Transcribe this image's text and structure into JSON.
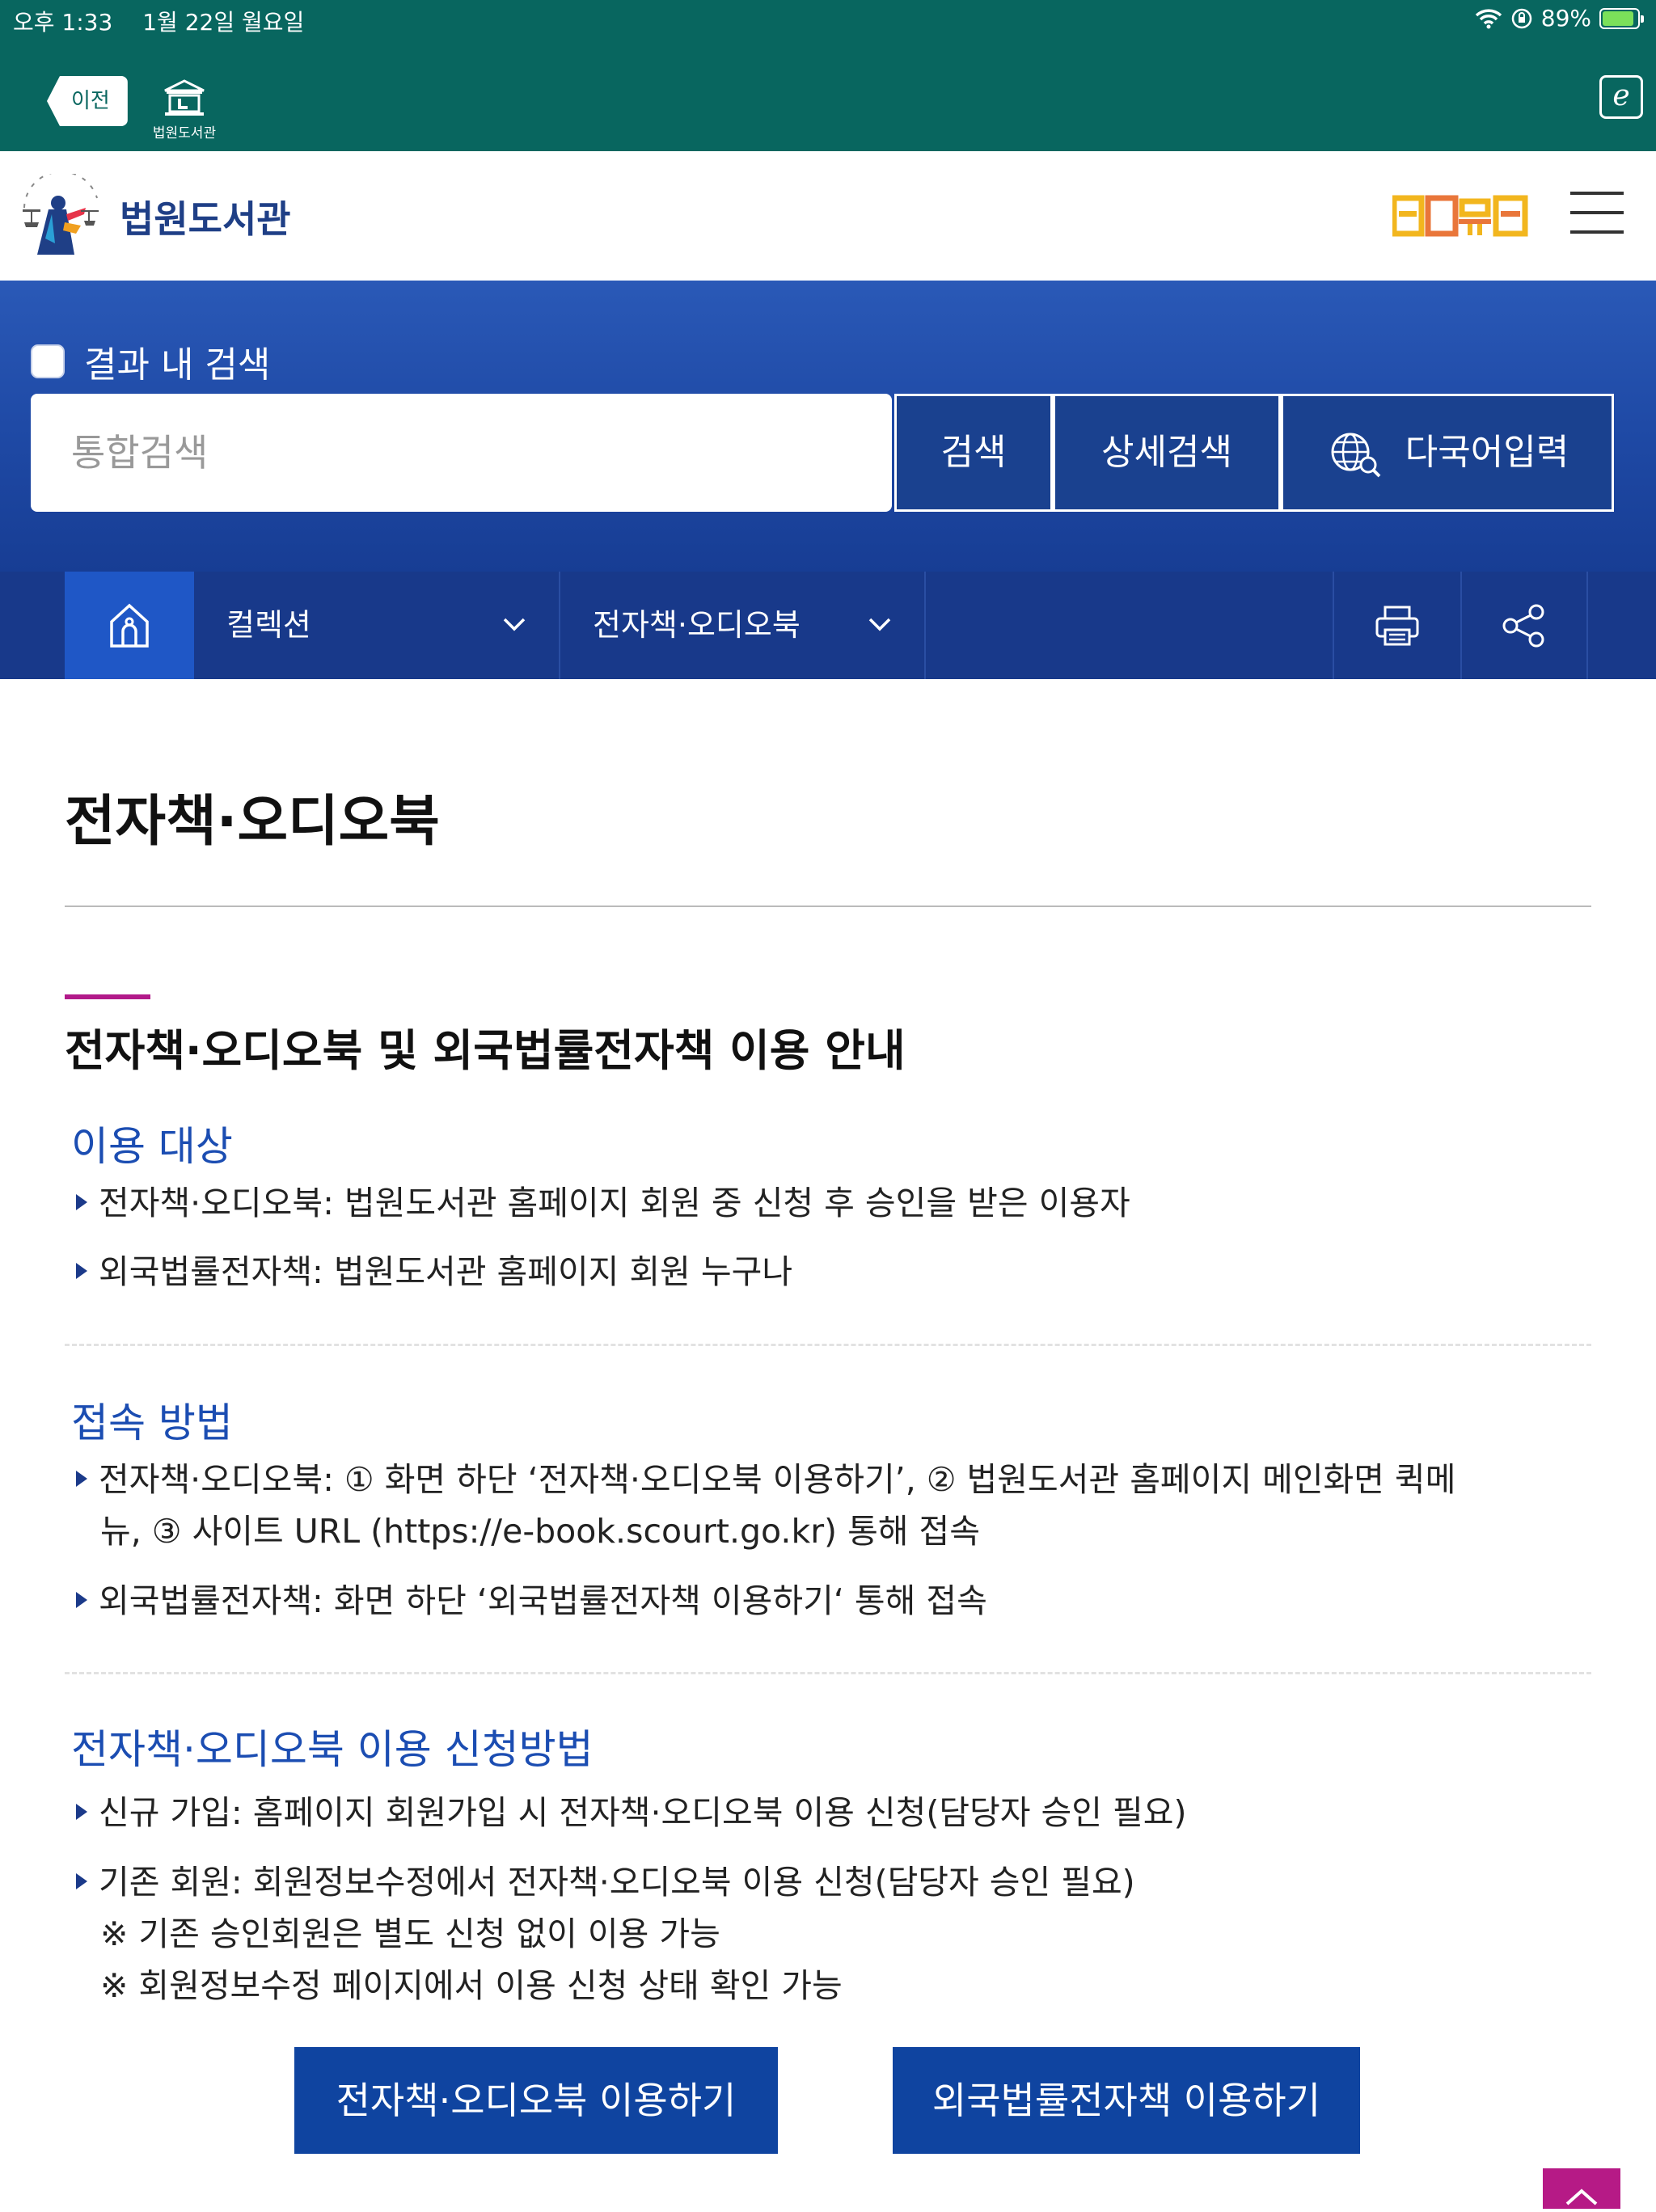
{
  "status_bar": {
    "time": "오후 1:33",
    "date": "1월 22일 월요일",
    "battery": "89%"
  },
  "toolbar": {
    "back_label": "이전",
    "library_label": "법원도서관"
  },
  "header": {
    "site_name": "법원도서관",
    "baro_logo": "바로마루"
  },
  "search": {
    "checkbox_label": "결과 내 검색",
    "placeholder": "통합검색",
    "search_button": "검색",
    "detail_button": "상세검색",
    "multilang_button": "다국어입력"
  },
  "nav": {
    "collection": "컬렉션",
    "ebook": "전자책·오디오북"
  },
  "content": {
    "page_title": "전자책·오디오북",
    "section_title": "전자책·오디오북 및 외국법률전자책 이용 안내",
    "usage_target": {
      "title": "이용 대상",
      "items": [
        "전자책·오디오북: 법원도서관 홈페이지 회원 중 신청 후 승인을 받은 이용자",
        "외국법률전자책: 법원도서관 홈페이지 회원 누구나"
      ]
    },
    "access_method": {
      "title": "접속 방법",
      "item1_line1": "전자책·오디오북: ① 화면 하단 ‘전자책·오디오북 이용하기’, ② 법원도서관 홈페이지 메인화면 퀵메",
      "item1_line2": "뉴, ③ 사이트 URL (https://e-book.scourt.go.kr) 통해 접속",
      "item2": "외국법률전자책: 화면 하단 ‘외국법률전자책 이용하기‘ 통해 접속"
    },
    "apply_method": {
      "title": "전자책·오디오북 이용 신청방법",
      "item1": "신규 가입: 홈페이지 회원가입 시 전자책·오디오북 이용 신청(담당자 승인 필요)",
      "item2": "기존 회원: 회원정보수정에서 전자책·오디오북 이용 신청(담당자 승인 필요)",
      "note1": "※ 기존 승인회원은 별도 신청 없이 이용 가능",
      "note2": "※ 회원정보수정 페이지에서 이용 신청 상태 확인 가능"
    },
    "ebook_button": "전자책·오디오북 이용하기",
    "foreign_button": "외국법률전자책 이용하기"
  },
  "colors": {
    "toolbar": "#08665f",
    "brand_blue": "#1f3f86",
    "nav": "#18398a",
    "nav_home": "#1f57c6",
    "accent": "#b21a8a",
    "button": "#0f44a0"
  }
}
